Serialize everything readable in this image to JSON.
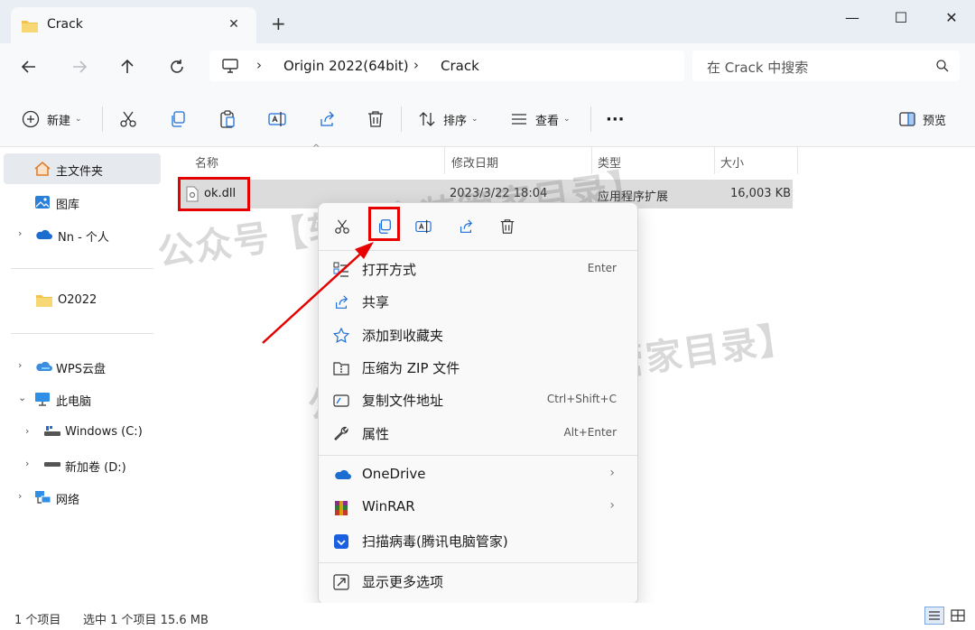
{
  "window": {
    "tab_title": "Crack",
    "new_tab": "+",
    "minimize": "—",
    "maximize": "☐",
    "close": "✕"
  },
  "address": {
    "crumbs": [
      "Origin 2022(64bit)",
      "Crack"
    ],
    "search_placeholder": "在 Crack 中搜索"
  },
  "toolbar": {
    "new_label": "新建",
    "sort_label": "排序",
    "view_label": "查看",
    "more_label": "···",
    "preview_label": "预览"
  },
  "sidebar": {
    "items": [
      {
        "label": "主文件夹",
        "icon": "home-icon"
      },
      {
        "label": "图库",
        "icon": "gallery-icon"
      },
      {
        "label": "Nn - 个人",
        "icon": "onedrive-icon"
      },
      {
        "label": "O2022",
        "icon": "folder-icon"
      },
      {
        "label": "WPS云盘",
        "icon": "cloud-icon"
      },
      {
        "label": "此电脑",
        "icon": "pc-icon"
      },
      {
        "label": "Windows (C:)",
        "icon": "drive-icon"
      },
      {
        "label": "新加卷 (D:)",
        "icon": "drive-icon"
      },
      {
        "label": "网络",
        "icon": "network-icon"
      }
    ]
  },
  "columns": {
    "name": "名称",
    "modified": "修改日期",
    "type": "类型",
    "size": "大小"
  },
  "files": [
    {
      "name": "ok.dll",
      "modified": "2023/3/22 18:04",
      "type": "应用程序扩展",
      "size": "16,003 KB"
    }
  ],
  "context_menu": {
    "items": [
      {
        "label": "打开方式",
        "shortcut": "Enter",
        "icon": "open-with-icon"
      },
      {
        "label": "共享",
        "shortcut": "",
        "icon": "share-icon"
      },
      {
        "label": "添加到收藏夹",
        "shortcut": "",
        "icon": "star-icon"
      },
      {
        "label": "压缩为 ZIP 文件",
        "shortcut": "",
        "icon": "zip-icon"
      },
      {
        "label": "复制文件地址",
        "shortcut": "Ctrl+Shift+C",
        "icon": "copy-path-icon"
      },
      {
        "label": "属性",
        "shortcut": "Alt+Enter",
        "icon": "wrench-icon"
      },
      {
        "label": "OneDrive",
        "shortcut": "",
        "icon": "onedrive-icon"
      },
      {
        "label": "WinRAR",
        "shortcut": "",
        "icon": "winrar-icon"
      },
      {
        "label": "扫描病毒(腾讯电脑管家)",
        "shortcut": "",
        "icon": "shield-icon"
      },
      {
        "label": "显示更多选项",
        "shortcut": "",
        "icon": "more-options-icon"
      }
    ],
    "submenu_arrow": "›"
  },
  "status": {
    "count": "1 个项目",
    "selected": "选中 1 个项目  15.6 MB"
  },
  "watermark": {
    "text": "公众号【软件安装管家目录】"
  },
  "colors": {
    "accent": "#0067c0",
    "highlight_red": "#e60000",
    "selection": "#dcdcdc"
  }
}
